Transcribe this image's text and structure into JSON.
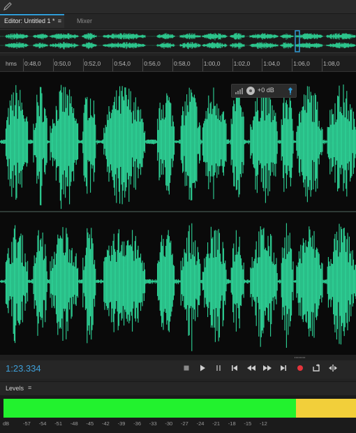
{
  "editor": {
    "tab_label": "Editor: Untitled 1 *",
    "tab_menu": "≡",
    "mixer_label": "Mixer"
  },
  "ruler": {
    "unit": "hms",
    "ticks": [
      "0:48,0",
      "0:50,0",
      "0:52,0",
      "0:54,0",
      "0:56,0",
      "0:58,0",
      "1:00,0",
      "1:02,0",
      "1:04,0",
      "1:06,0",
      "1:08,0"
    ]
  },
  "hud": {
    "volume": "+0 dB"
  },
  "transport": {
    "timecode": "1:23.334",
    "buttons": [
      "stop-icon",
      "play-icon",
      "pause-icon",
      "go-to-start-icon",
      "rewind-icon",
      "fast-forward-icon",
      "go-to-end-icon",
      "record-icon",
      "loop-icon",
      "skip-selection-icon"
    ]
  },
  "levels": {
    "title": "Levels",
    "menu": "≡",
    "green_fraction": 0.83,
    "scale": [
      "dB",
      "-57",
      "-54",
      "-51",
      "-48",
      "-45",
      "-42",
      "-39",
      "-36",
      "-33",
      "-30",
      "-27",
      "-24",
      "-21",
      "-18",
      "-15",
      "-12"
    ]
  },
  "colors": {
    "waveform": "#2fd89a",
    "accent": "#2f9bd6",
    "meter_green": "#22f22e",
    "meter_yellow": "#f2cf3a"
  }
}
